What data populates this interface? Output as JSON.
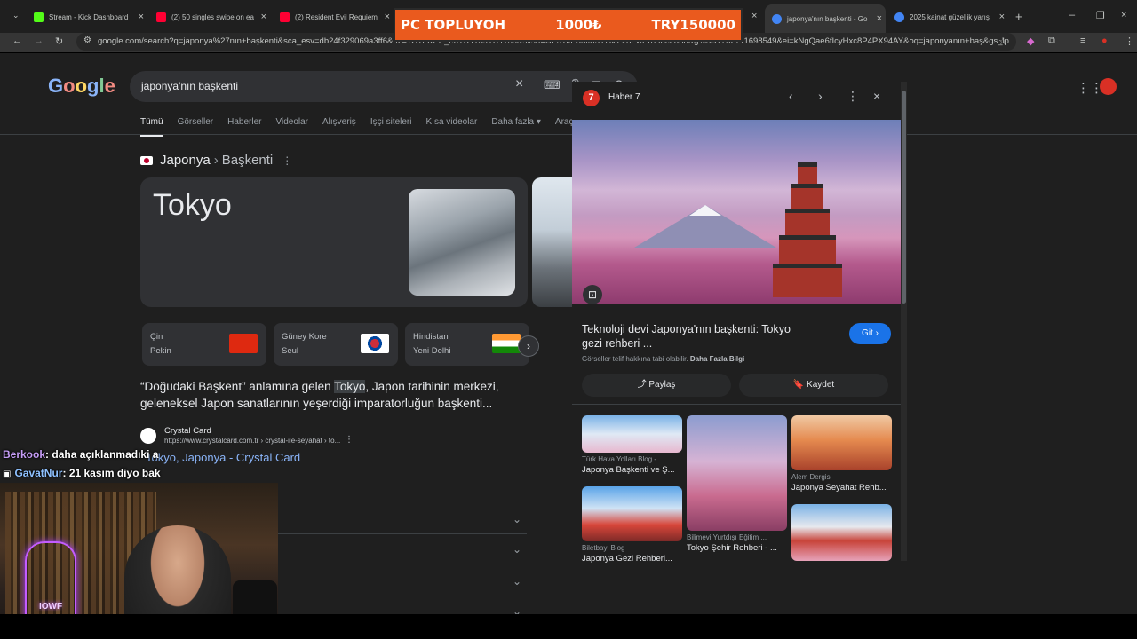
{
  "browser": {
    "tabs": [
      {
        "title": "Stream - Kick Dashboard",
        "color": "#53fc18"
      },
      {
        "title": "(2) 50 singles swipe on ea",
        "color": "#ff0033"
      },
      {
        "title": "(2) Resident Evil Requiem",
        "color": "#ff0033"
      },
      {
        "title": "japonya'nın başkenti - Go",
        "color": "#4285f4"
      },
      {
        "title": "2025 kainat güzellik yarış",
        "color": "#4285f4"
      }
    ],
    "url": "google.com/search?q=japonya%27nın+başkenti&sca_esv=db24f329069a3ff6&rlz=1C1FKPE_enTR1139TR1139&sxsrf=AE3TifP5MM5YHxTV8FwEnVfdcLd58Kg%3A1762711698549&ei=kNgQae6fIcyHxc8P4PX94AY&oq=japonyanın+baş&gs_lp..."
  },
  "banner": {
    "left": "PC TOPLUYOH",
    "middle": "1000₺",
    "right": "TRY150000"
  },
  "google": {
    "logo": "Google",
    "query": "japonya'nın başkenti",
    "nav_tabs": [
      "Tümü",
      "Görseller",
      "Haberler",
      "Videolar",
      "Alışveriş",
      "Işçi siteleri",
      "Kısa videolar",
      "Daha fazla ▾",
      "Araçlar ▾"
    ]
  },
  "knowledge": {
    "entity": "Japonya",
    "attribute": "Başkenti",
    "answer": "Tokyo",
    "cities": [
      {
        "country": "Çin",
        "capital": "Pekin"
      },
      {
        "country": "Güney Kore",
        "capital": "Seul"
      },
      {
        "country": "Hindistan",
        "capital": "Yeni Delhi"
      }
    ],
    "description_pre": "“Doğudaki Başkent” anlamına gelen ",
    "description_hl": "Tokyo",
    "description_post": ", Japon tarihinin merkezi, geleneksel Japon sanatlarının yeşerdiği imparatorluğun başkenti...",
    "source_name": "Crystal Card",
    "source_url": "https://www.crystalcard.com.tr › crystal-ile-seyahat › to...",
    "source_title": "Tokyo, Japonya - Crystal Card"
  },
  "viewer": {
    "source": "Haber 7",
    "source_initial": "7",
    "title": "Teknoloji devi Japonya'nın başkenti: Tokyo gezi rehberi ...",
    "visit": "Git ›",
    "rights": "Görseller telif hakkına tabi olabilir.",
    "rights_link": "Daha Fazla Bilgi",
    "share": "⤴ Paylaş",
    "save": "🔖 Kaydet",
    "related": [
      {
        "source": "Türk Hava Yolları Blog - ...",
        "title": "Japonya Başkenti ve Ş..."
      },
      {
        "source": "Bilimevi Yurtdışı Eğitim ...",
        "title": "Tokyo Şehir Rehberi - ..."
      },
      {
        "source": "Alem Dergisi",
        "title": "Japonya Seyahat Rehb..."
      },
      {
        "source": "Biletbayi Blog",
        "title": "Japonya Gezi Rehberi..."
      }
    ]
  },
  "chat": [
    {
      "user": "Berkook",
      "message": ": daha açıklanmadıki a"
    },
    {
      "user": "GavatNur",
      "message": ": 21 kasım diyo bak"
    }
  ],
  "webcam": {
    "label": "IOWF"
  }
}
